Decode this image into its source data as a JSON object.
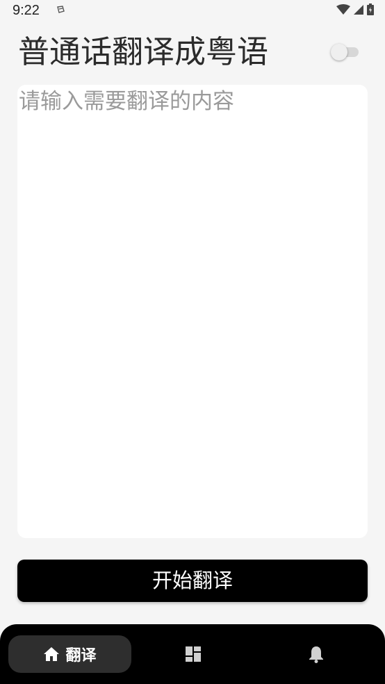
{
  "status_bar": {
    "time": "9:22"
  },
  "header": {
    "title": "普通话翻译成粤语"
  },
  "input": {
    "placeholder": "请输入需要翻译的内容",
    "value": ""
  },
  "actions": {
    "translate_label": "开始翻译"
  },
  "bottom_nav": {
    "items": [
      {
        "label": "翻译",
        "icon": "home-icon",
        "active": true
      },
      {
        "label": "",
        "icon": "dashboard-icon",
        "active": false
      },
      {
        "label": "",
        "icon": "bell-icon",
        "active": false
      }
    ]
  },
  "colors": {
    "background": "#f5f5f5",
    "button": "#000000",
    "nav_background": "#000000",
    "nav_active": "#2e2e2e",
    "placeholder": "#9a9a9a"
  }
}
